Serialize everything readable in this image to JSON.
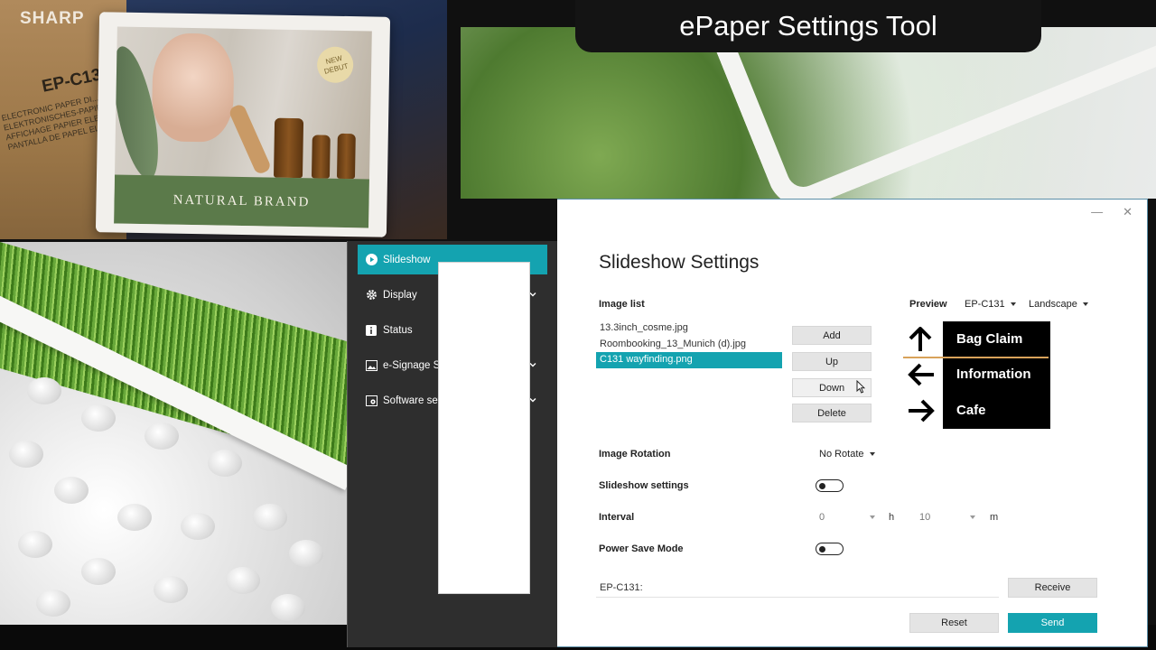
{
  "title_banner": "ePaper Settings Tool",
  "box_photo": {
    "carton_brand": "SHARP",
    "carton_model": "EP-C131",
    "carton_text": "ELECTRONIC PAPER DI... ELEKTRONISCHES-PAPIER... AFFICHAGE PAPIER ELEC... PANTALLA DE PAPEL EL...",
    "badge_text": "NEW DEBUT",
    "poster_brand": "NATURAL BRAND"
  },
  "sidebar": {
    "items": [
      {
        "label": "Slideshow",
        "icon": "play-icon",
        "active": true
      },
      {
        "label": "Display",
        "icon": "gear-icon",
        "chevron": true
      },
      {
        "label": "Status",
        "icon": "info-icon"
      },
      {
        "label": "e-Signage S",
        "icon": "image-icon",
        "chevron": true
      },
      {
        "label": "Software set",
        "icon": "software-settings-icon",
        "chevron": true
      }
    ]
  },
  "window": {
    "minimize": "—",
    "close": "✕"
  },
  "main": {
    "page_title": "Slideshow Settings",
    "image_list_label": "Image list",
    "files": [
      "13.3inch_cosme.jpg",
      "Roombooking_13_Munich (d).jpg",
      "C131 wayfinding.png"
    ],
    "selected_index": 2,
    "buttons": {
      "add": "Add",
      "up": "Up",
      "down": "Down",
      "delete": "Delete"
    },
    "preview": {
      "label": "Preview",
      "model_value": "EP-C131",
      "orientation_value": "Landscape",
      "rows": [
        {
          "arrow": "arrow-up-icon",
          "text": "Bag Claim"
        },
        {
          "arrow": "arrow-left-icon",
          "text": "Information"
        },
        {
          "arrow": "arrow-right-icon",
          "text": "Cafe"
        }
      ],
      "divider_color": "#d8a25a"
    },
    "rotation": {
      "label": "Image Rotation",
      "value": "No Rotate"
    },
    "slideshow_toggle": {
      "label": "Slideshow settings",
      "on": false
    },
    "interval": {
      "label": "Interval",
      "hours": "0",
      "hours_unit": "h",
      "minutes": "10",
      "minutes_unit": "m"
    },
    "power_save": {
      "label": "Power Save Mode",
      "on": false
    },
    "status_text": "EP-C131:",
    "receive_button": "Receive",
    "reset_button": "Reset",
    "send_button": "Send"
  },
  "colors": {
    "accent": "#14a3b0",
    "sidebar_bg": "#2e2e2e",
    "banner_bg": "#141414"
  }
}
